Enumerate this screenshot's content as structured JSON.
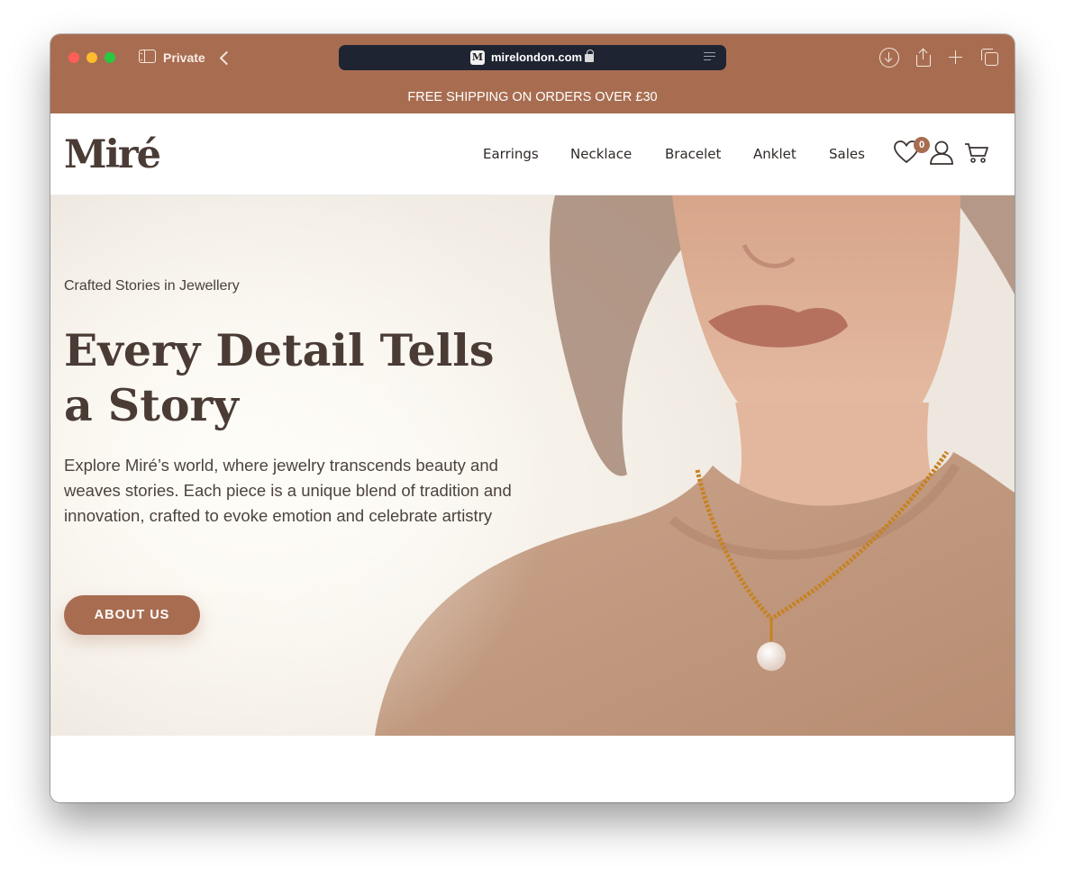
{
  "browser": {
    "private_label": "Private",
    "url": "mirelondon.com",
    "favicon_letter": "M",
    "chrome_color": "#a86d51"
  },
  "promo": {
    "text": "FREE SHIPPING ON ORDERS OVER £30"
  },
  "header": {
    "logo": "Miré",
    "nav": [
      "Earrings",
      "Necklace",
      "Bracelet",
      "Anklet",
      "Sales"
    ],
    "wishlist_count": "0",
    "icons": [
      "heart-icon",
      "user-icon",
      "cart-icon"
    ]
  },
  "hero": {
    "kicker": "Crafted Stories in Jewellery",
    "title": "Every Detail Tells a Story",
    "description": "Explore Miré’s world, where jewelry transcends beauty and weaves stories. Each piece is a unique blend of tradition and innovation, crafted to evoke emotion and celebrate artistry",
    "cta": "ABOUT US",
    "accent": "#a86d51",
    "text_color": "#4a3c35"
  }
}
